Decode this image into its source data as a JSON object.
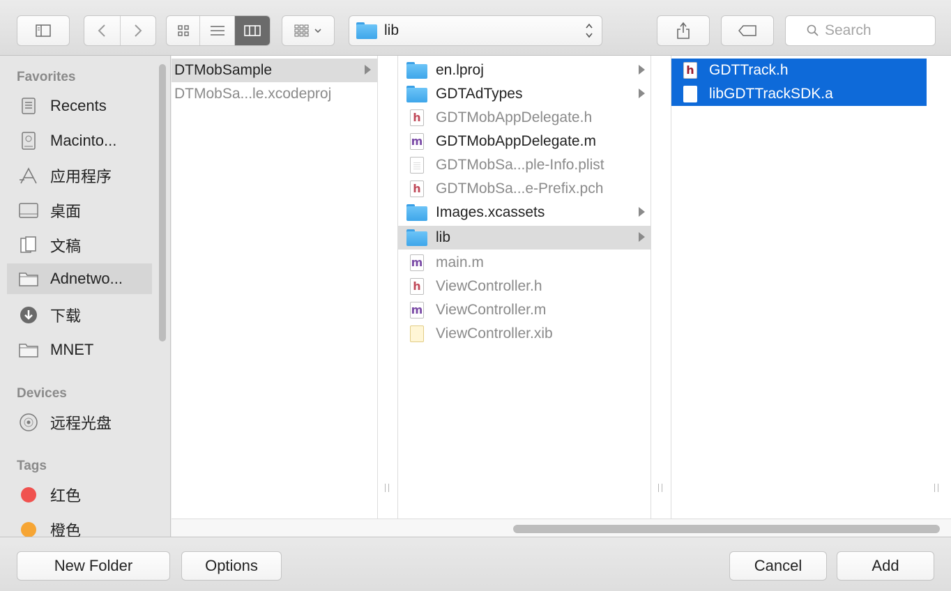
{
  "toolbar": {
    "path_label": "lib",
    "search_placeholder": "Search"
  },
  "sidebar": {
    "favorites_header": "Favorites",
    "favorites": [
      {
        "label": "Recents",
        "icon": "recents-icon"
      },
      {
        "label": "Macinto...",
        "icon": "hard-drive-icon"
      },
      {
        "label": "应用程序",
        "icon": "applications-icon"
      },
      {
        "label": "桌面",
        "icon": "desktop-icon"
      },
      {
        "label": "文稿",
        "icon": "documents-icon"
      },
      {
        "label": "Adnetwo...",
        "icon": "folder-icon"
      },
      {
        "label": "下载",
        "icon": "downloads-icon"
      },
      {
        "label": "MNET",
        "icon": "folder-icon"
      }
    ],
    "devices_header": "Devices",
    "devices": [
      {
        "label": "远程光盘",
        "icon": "disc-icon"
      }
    ],
    "tags_header": "Tags",
    "tags": [
      {
        "label": "红色",
        "color": "#f0524f"
      },
      {
        "label": "橙色",
        "color": "#f6a534"
      }
    ]
  },
  "columns": {
    "col1": [
      {
        "name": "DTMobSample"
      },
      {
        "name": "DTMobSa...le.xcodeproj"
      }
    ],
    "col2": [
      {
        "name": "en.lproj"
      },
      {
        "name": "GDTAdTypes"
      },
      {
        "name": "GDTMobAppDelegate.h"
      },
      {
        "name": "GDTMobAppDelegate.m"
      },
      {
        "name": "GDTMobSa...ple-Info.plist"
      },
      {
        "name": "GDTMobSa...e-Prefix.pch"
      },
      {
        "name": "Images.xcassets"
      },
      {
        "name": "lib"
      },
      {
        "name": "main.m"
      },
      {
        "name": "ViewController.h"
      },
      {
        "name": "ViewController.m"
      },
      {
        "name": "ViewController.xib"
      }
    ],
    "col3": [
      {
        "name": "GDTTrack.h"
      },
      {
        "name": "libGDTTrackSDK.a"
      }
    ]
  },
  "footer": {
    "new_folder_label": "New Folder",
    "options_label": "Options",
    "cancel_label": "Cancel",
    "add_label": "Add"
  },
  "colors": {
    "selection_blue": "#0e6ad9",
    "folder_blue": "#4fb3f3"
  }
}
